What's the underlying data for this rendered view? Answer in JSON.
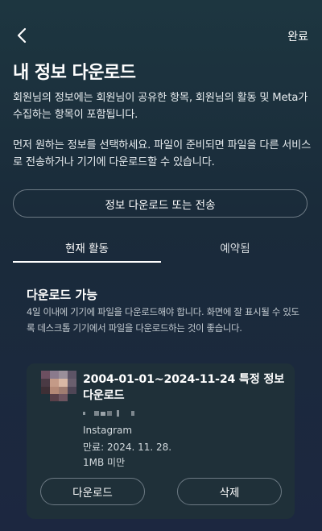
{
  "header": {
    "done_label": "완료"
  },
  "page_title": "내 정보 다운로드",
  "intro_text": "회원님의 정보에는 회원님이 공유한 항목, 회원님의 활동 및 Meta가 수집하는 항목이 포함됩니다.",
  "instruction_text": "먼저 원하는 정보를 선택하세요. 파일이 준비되면 파일을 다른 서비스로 전송하거나 기기에 다운로드할 수 있습니다.",
  "primary_button_label": "정보 다운로드 또는 전송",
  "tabs": [
    {
      "label": "현재 활동",
      "selected": true
    },
    {
      "label": "예약됨",
      "selected": false
    }
  ],
  "section": {
    "title": "다운로드 가능",
    "description": "4일 이내에 기기에 파일을 다운로드해야 합니다. 화면에 잘 표시될 수 있도록 데스크톱 기기에서 파일을 다운로드하는 것이 좋습니다."
  },
  "download_card": {
    "title": "2004-01-01~2024-11-24 특정 정보 다운로드",
    "platform": "Instagram",
    "expiry": "만료: 2024. 11. 28.",
    "size": "1MB 미만",
    "download_label": "다운로드",
    "delete_label": "삭제"
  },
  "colors": {
    "background": "#1a2b3a",
    "card": "#1f3039",
    "border": "#6d7a84"
  }
}
